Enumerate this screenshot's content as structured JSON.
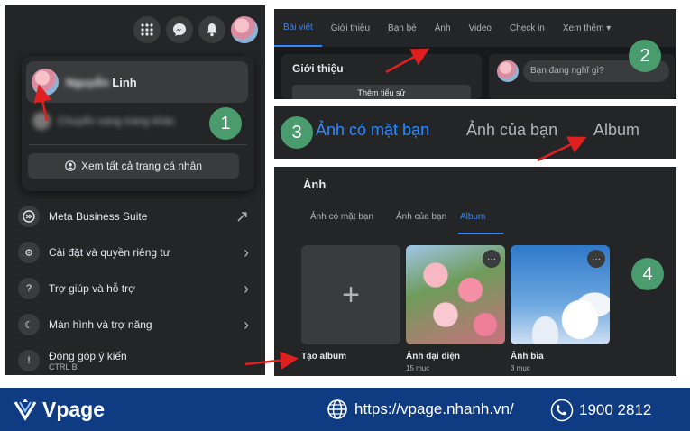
{
  "colors": {
    "accent": "#2d88ff",
    "badge": "#4a9b6e",
    "footer": "#0f3b82",
    "arrow": "#e02020"
  },
  "panel1": {
    "profile_name": "Nguyễn Linh",
    "profile_name_visible": "Linh",
    "sub_item": "Chuyển sang trang khác",
    "see_all": "Xem tất cả trang cá nhân",
    "menu": [
      {
        "label": "Meta Business Suite",
        "icon": "meta-icon",
        "trail": "↗"
      },
      {
        "label": "Cài đặt và quyền riêng tư",
        "icon": "gear-icon",
        "trail": "›"
      },
      {
        "label": "Trợ giúp và hỗ trợ",
        "icon": "help-icon",
        "trail": "›"
      },
      {
        "label": "Màn hình và trợ năng",
        "icon": "moon-icon",
        "trail": "›"
      },
      {
        "label": "Đóng góp ý kiến",
        "sub": "CTRL B",
        "icon": "feedback-icon",
        "trail": ""
      }
    ],
    "step": "1"
  },
  "panel2": {
    "tabs": [
      "Bài viết",
      "Giới thiệu",
      "Bạn bè",
      "Ảnh",
      "Video",
      "Check in",
      "Xem thêm ▾"
    ],
    "intro_title": "Giới thiệu",
    "add_bio": "Thêm tiểu sử",
    "composer_placeholder": "Bạn đang nghĩ gì?",
    "step": "2"
  },
  "panel3": {
    "tabs": [
      "Ảnh có mặt bạn",
      "Ảnh của bạn",
      "Album"
    ],
    "step": "3"
  },
  "panel4": {
    "title": "Ảnh",
    "tabs": [
      "Ảnh có mặt bạn",
      "Ảnh của bạn",
      "Album"
    ],
    "albums": [
      {
        "name": "Tạo album",
        "count": ""
      },
      {
        "name": "Ảnh đại diện",
        "count": "15 mục"
      },
      {
        "name": "Ảnh bìa",
        "count": "3 mục"
      }
    ],
    "more": "···",
    "step": "4"
  },
  "footer": {
    "brand": "Vpage",
    "url": "https://vpage.nhanh.vn/",
    "phone": "1900 2812"
  }
}
